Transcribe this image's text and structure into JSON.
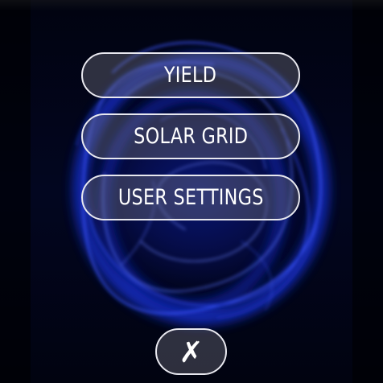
{
  "menu": {
    "items": [
      {
        "label": "YIELD"
      },
      {
        "label": "SOLAR GRID"
      },
      {
        "label": "USER SETTINGS"
      }
    ]
  },
  "close": {
    "glyph": "✗",
    "icon": "close-icon"
  },
  "background": {
    "icon": "blue-energy-swirl",
    "accent": "#1a3bff"
  }
}
